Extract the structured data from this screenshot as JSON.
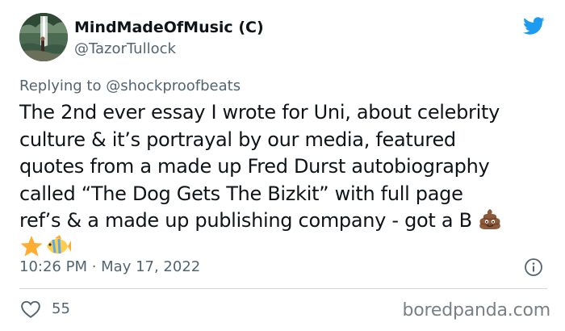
{
  "author": {
    "display_name": "MindMadeOfMusic (C)",
    "handle": "@TazorTullock",
    "avatar_icon": "profile-photo-waterfall",
    "platform_icon": "twitter-bird-icon",
    "platform_color": "#1d9bf0"
  },
  "reply": {
    "prefix": "Replying to",
    "mention": "@shockproofbeats"
  },
  "tweet": {
    "lines": [
      "The 2nd ever essay I wrote for Uni, about celebrity",
      "culture & it’s portrayal by our media, featured",
      "quotes from a made up Fred Durst autobiography",
      "called “The Dog Gets The Bizkit” with full page",
      "ref’s & a made up publishing company - got a B"
    ],
    "emojis": [
      "pile-of-poo-emoji",
      "star-emoji",
      "tropical-fish-emoji"
    ],
    "timestamp": "10:26 PM · May 17, 2022"
  },
  "engagement": {
    "like_count": "55",
    "like_icon": "heart-icon"
  },
  "watermark": "boredpanda.com"
}
